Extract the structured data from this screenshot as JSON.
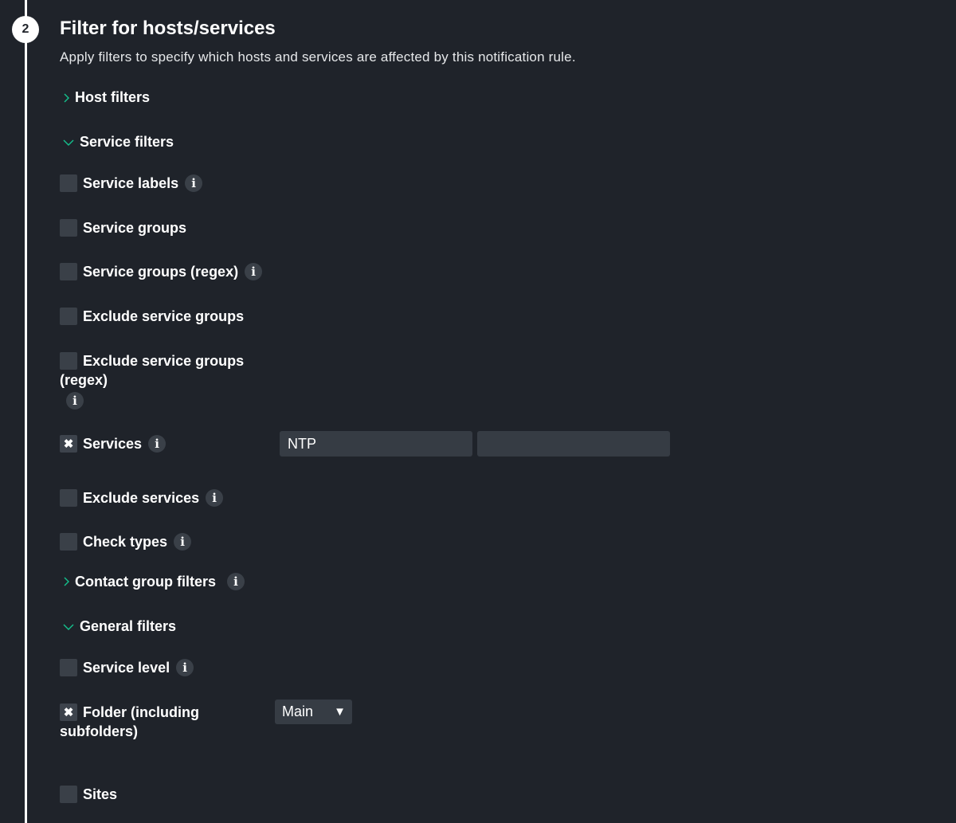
{
  "step": {
    "number": "2"
  },
  "section": {
    "title": "Filter for hosts/services",
    "description": "Apply filters to specify which hosts and services are affected by this notification rule."
  },
  "groups": {
    "host_filters": {
      "label": "Host filters",
      "expanded": false
    },
    "service_filters": {
      "label": "Service filters",
      "expanded": true
    },
    "contact_group_filters": {
      "label": "Contact group filters",
      "expanded": false
    },
    "general_filters": {
      "label": "General filters",
      "expanded": true
    }
  },
  "service_filters": {
    "service_labels": {
      "label": "Service labels",
      "checked": false
    },
    "service_groups": {
      "label": "Service groups",
      "checked": false
    },
    "service_groups_regex": {
      "label": "Service groups (regex)",
      "checked": false
    },
    "exclude_service_groups": {
      "label": "Exclude service groups",
      "checked": false
    },
    "exclude_service_groups_regex": {
      "label_line1": "Exclude service groups",
      "label_line2": "(regex)",
      "checked": false
    },
    "services": {
      "label": "Services",
      "checked": true,
      "values": [
        "NTP",
        ""
      ]
    },
    "exclude_services": {
      "label": "Exclude services",
      "checked": false
    },
    "check_types": {
      "label": "Check types",
      "checked": false
    }
  },
  "general_filters": {
    "service_level": {
      "label": "Service level",
      "checked": false
    },
    "folder": {
      "label_line1": "Folder (including",
      "label_line2": "subfolders)",
      "checked": true,
      "selected": "Main"
    },
    "sites": {
      "label": "Sites",
      "checked": false
    }
  },
  "icons": {
    "checked_mark": "✖",
    "info": "i",
    "dropdown_arrow": "▼"
  },
  "colors": {
    "background": "#1f232a",
    "accent": "#14c28e",
    "input_bg": "#363c44"
  }
}
